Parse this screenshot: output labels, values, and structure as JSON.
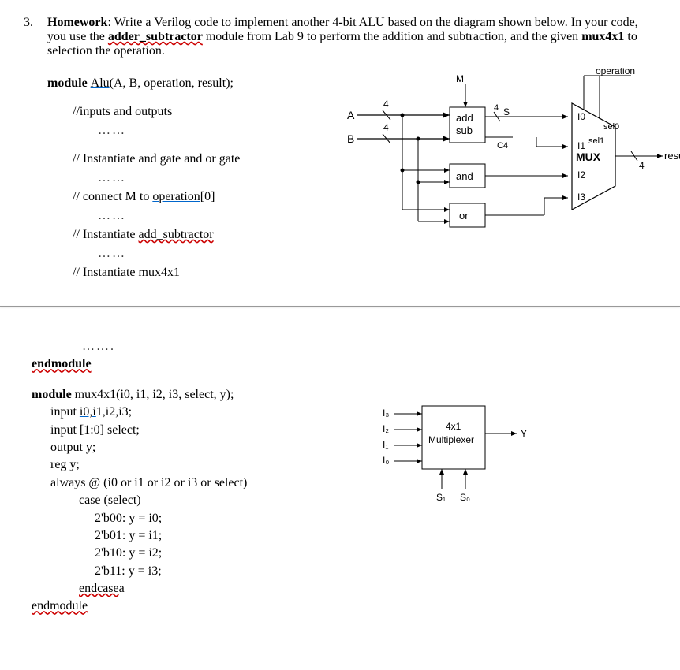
{
  "question": {
    "number": "3.",
    "label": "Homework",
    "text_before": ": Write a Verilog code to implement another 4-bit ALU based on the diagram shown below. In your code, you use the ",
    "adder_sub": "adder_subtractor",
    "text_mid": " module from Lab 9 to perform the addition and subtraction, and the given ",
    "mux4x1": "mux4x1",
    "text_after": " to selection the operation."
  },
  "module_decl": {
    "kw": "module ",
    "name": "Alu",
    "params": "(A, B, operation, result);"
  },
  "comments": {
    "io": "//inputs and outputs",
    "inst_gates": "// Instantiate and gate and or gate",
    "connect_m_pre": "// connect M to ",
    "connect_m_link": "operation[",
    "connect_m_post": "0]",
    "inst_addsub_pre": "// Instantiate ",
    "inst_addsub_link": "add_subtractor",
    "inst_mux": "// Instantiate mux4x1",
    "dots": "……",
    "dots2": "…….",
    "endmodule": "endmodule"
  },
  "diagram1": {
    "A": "A",
    "B": "B",
    "four": "4",
    "M": "M",
    "addsub_l1": "add",
    "addsub_l2": "sub",
    "and": "and",
    "or": "or",
    "S": "S",
    "C4": "C4",
    "operation": "operation",
    "I0": "I0",
    "I1": "I1",
    "I2": "I2",
    "I3": "I3",
    "sel0": "sel0",
    "sel1": "sel1",
    "MUX": "MUX",
    "result": "result",
    "four_out": "4"
  },
  "mux_code": {
    "decl_kw": "module ",
    "decl_rest": "mux4x1(i0, i1, i2, i3, select, y);",
    "input1_pre": "input ",
    "input1_link": "i0,i",
    "input1_post": "1,i2,i3;",
    "input2": "input [1:0] select;",
    "output": "output y;",
    "reg": "reg y;",
    "always": "always @ (i0 or i1 or i2 or i3 or select)",
    "case": "case (select)",
    "c0": "2'b00: y = i0;",
    "c1": "2'b01: y = i1;",
    "c2": "2'b10: y = i2;",
    "c3": "2'b11: y = i3;",
    "endcase_pre": "endcase",
    "endcase_post": "a",
    "endmodule": "endmodule"
  },
  "diagram2": {
    "I3": "I₃",
    "I2": "I₂",
    "I1": "I₁",
    "I0": "I₀",
    "box_l1": "4x1",
    "box_l2": "Multiplexer",
    "Y": "Y",
    "S1": "S₁",
    "S0": "S₀"
  }
}
